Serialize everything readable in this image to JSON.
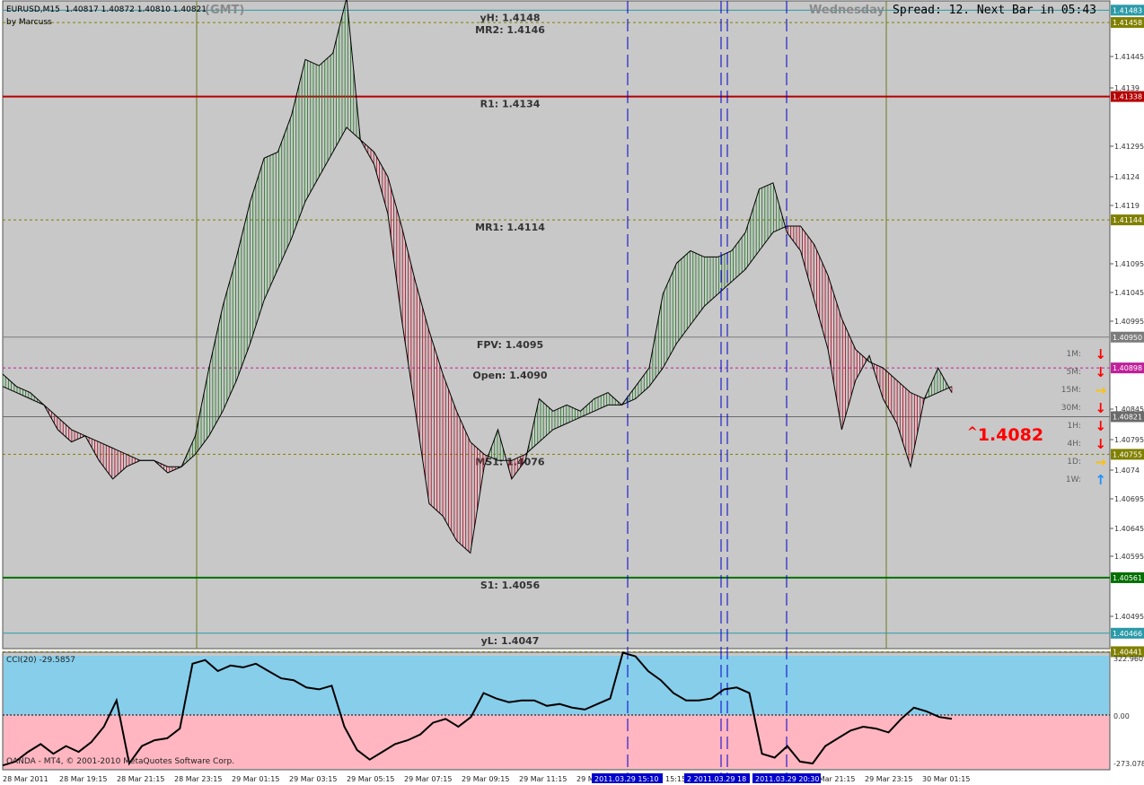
{
  "header": {
    "symbol_line": "EURUSD,M15  1.40817 1.40872 1.40810 1.40821",
    "author": "by Marcuss",
    "timezone": "(GMT)",
    "weekday": "Wednesday",
    "spread_text": "Spread: 12. Next Bar in 05:43"
  },
  "levels": [
    {
      "name": "yH",
      "label": "yH: 1.4148",
      "value": 1.4148,
      "tag": "1.41483",
      "style": "solid",
      "color": "#2a9aa8"
    },
    {
      "name": "MR2",
      "label": "MR2: 1.4146",
      "value": 1.4146,
      "tag": "1.41458",
      "style": "dotted",
      "color": "#808000"
    },
    {
      "name": "R1",
      "label": "R1: 1.4134",
      "value": 1.4134,
      "tag": "1.41338",
      "style": "solid",
      "color": "#b40000"
    },
    {
      "name": "MR1",
      "label": "MR1: 1.4114",
      "value": 1.4114,
      "tag": "1.41144",
      "style": "dotted",
      "color": "#808000"
    },
    {
      "name": "FPV",
      "label": "FPV: 1.4095",
      "value": 1.4095,
      "tag": "1.40950",
      "style": "solid",
      "color": "#7c7c7c"
    },
    {
      "name": "Open",
      "label": "Open: 1.4090",
      "value": 1.409,
      "tag": "1.40898",
      "style": "dotted",
      "color": "#c0209a"
    },
    {
      "name": "Bid",
      "label": "",
      "value": 1.40821,
      "tag": "1.40821",
      "style": "solid",
      "color": "#6a6a6a"
    },
    {
      "name": "MS1",
      "label": "MS1: 1.4076",
      "value": 1.4076,
      "tag": "1.40755",
      "style": "dotted",
      "color": "#808000"
    },
    {
      "name": "S1",
      "label": "S1: 1.4056",
      "value": 1.4056,
      "tag": "1.40561",
      "style": "solid",
      "color": "#007000"
    },
    {
      "name": "yL",
      "label": "yL: 1.4047",
      "value": 1.4047,
      "tag": "1.40466",
      "style": "solid",
      "color": "#2a9aa8"
    },
    {
      "name": "MS2",
      "label": "",
      "value": 1.4044,
      "tag": "1.40441",
      "style": "dotted",
      "color": "#808000"
    }
  ],
  "price_axis_ticks": [
    "1.41445",
    "1.4139",
    "1.41295",
    "1.4124",
    "1.4119",
    "1.41095",
    "1.41045",
    "1.40995",
    "1.40845",
    "1.40795",
    "1.4074",
    "1.40695",
    "1.40645",
    "1.40595",
    "1.40495"
  ],
  "price_big": "1.4082",
  "price_caret": "^",
  "timeframes": [
    {
      "label": "1M:",
      "dir": "down",
      "color": "#ff0000"
    },
    {
      "label": "5M:",
      "dir": "down",
      "color": "#ff0000"
    },
    {
      "label": "15M:",
      "dir": "right",
      "color": "#ffc000"
    },
    {
      "label": "30M:",
      "dir": "down",
      "color": "#ff0000"
    },
    {
      "label": "1H:",
      "dir": "down",
      "color": "#ff0000"
    },
    {
      "label": "4H:",
      "dir": "down",
      "color": "#ff0000"
    },
    {
      "label": "1D:",
      "dir": "right",
      "color": "#ffc000"
    },
    {
      "label": "1W:",
      "dir": "up",
      "color": "#1e90ff"
    }
  ],
  "time_axis": [
    "28 Mar 2011",
    "28 Mar 19:15",
    "28 Mar 21:15",
    "28 Mar 23:15",
    "29 Mar 01:15",
    "29 Mar 03:15",
    "29 Mar 05:15",
    "29 Mar 07:15",
    "29 Mar 09:15",
    "29 Mar 11:15",
    "29 M",
    "15:15",
    "29 Mar 21:15",
    "29 Mar 23:15",
    "30 Mar 01:15"
  ],
  "time_markers": [
    "2011.03.29 15:10",
    "2 2011.03.29 18",
    "2011.03.29 20:30"
  ],
  "cci": {
    "label": "CCI(20) -29.5857",
    "axis_labels": [
      "322.960",
      "0.00",
      "-273.078"
    ]
  },
  "footer": "OANDA - MT4, © 2001-2010 MetaQuotes Software Corp.",
  "colors": {
    "chart_bg": "#c8c8c8",
    "bull_fill": "#2e7d32",
    "bear_fill": "#b01830",
    "cci_upper": "#87ceeb",
    "cci_lower": "#ffb6c1",
    "vline": "#0000cc",
    "session": "#6b7d1e"
  },
  "chart_data": {
    "type": "line",
    "ylim": [
      1.40445,
      1.41495
    ],
    "series": [
      {
        "values": [
          1.4089,
          1.4087,
          1.4086,
          1.4084,
          1.408,
          1.4078,
          1.4079,
          1.4075,
          1.4072,
          1.4074,
          1.4075,
          1.4075,
          1.4073,
          1.4074,
          1.4079,
          1.409,
          1.41,
          1.4108,
          1.4117,
          1.4124,
          1.4125,
          1.4131,
          1.414,
          1.4139,
          1.4141,
          1.415,
          1.4127,
          1.4123,
          1.4115,
          1.4098,
          1.4083,
          1.4068,
          1.4066,
          1.4062,
          1.406,
          1.4074,
          1.408,
          1.4072,
          1.4075,
          1.4085,
          1.4083,
          1.4084,
          1.4083,
          1.4085,
          1.4086,
          1.4084,
          1.4087,
          1.409,
          1.4102,
          1.4107,
          1.4109,
          1.4108,
          1.4108,
          1.4109,
          1.4112,
          1.4119,
          1.412,
          1.4112,
          1.4109,
          1.4101,
          1.4093,
          1.408,
          1.4088,
          1.4092,
          1.4085,
          1.4081,
          1.4074,
          1.4085,
          1.409,
          1.4086
        ]
      },
      {
        "values": [
          1.4087,
          1.4086,
          1.4085,
          1.4084,
          1.4082,
          1.408,
          1.4079,
          1.4078,
          1.4077,
          1.4076,
          1.4075,
          1.4075,
          1.4074,
          1.4074,
          1.4076,
          1.4079,
          1.4083,
          1.4088,
          1.4094,
          1.4101,
          1.4106,
          1.4111,
          1.4117,
          1.4121,
          1.4125,
          1.4129,
          1.4127,
          1.4125,
          1.4121,
          1.4113,
          1.4104,
          1.4096,
          1.4089,
          1.4083,
          1.4078,
          1.4076,
          1.4075,
          1.4075,
          1.4076,
          1.4078,
          1.408,
          1.4081,
          1.4082,
          1.4083,
          1.4084,
          1.4084,
          1.4085,
          1.4087,
          1.409,
          1.4094,
          1.4097,
          1.41,
          1.4102,
          1.4104,
          1.4106,
          1.4109,
          1.4112,
          1.4113,
          1.4113,
          1.411,
          1.4105,
          1.4098,
          1.4093,
          1.4091,
          1.409,
          1.4088,
          1.4086,
          1.4085,
          1.4086,
          1.4087
        ]
      }
    ],
    "cci_values": [
      -260,
      -240,
      -190,
      -150,
      -200,
      -160,
      -190,
      -140,
      -60,
      80,
      -250,
      -160,
      -130,
      -120,
      -70,
      280,
      300,
      240,
      270,
      260,
      280,
      240,
      200,
      190,
      150,
      140,
      160,
      -60,
      -180,
      -230,
      -190,
      -150,
      -130,
      -100,
      -40,
      -20,
      -60,
      -10,
      120,
      90,
      70,
      80,
      80,
      50,
      60,
      40,
      30,
      60,
      90,
      340,
      320,
      240,
      190,
      120,
      80,
      80,
      90,
      140,
      150,
      120,
      -200,
      -220,
      -160,
      -240,
      -250,
      -160,
      -120,
      -80,
      -60,
      -70,
      -90,
      -20,
      40,
      20,
      -10,
      -20
    ]
  }
}
